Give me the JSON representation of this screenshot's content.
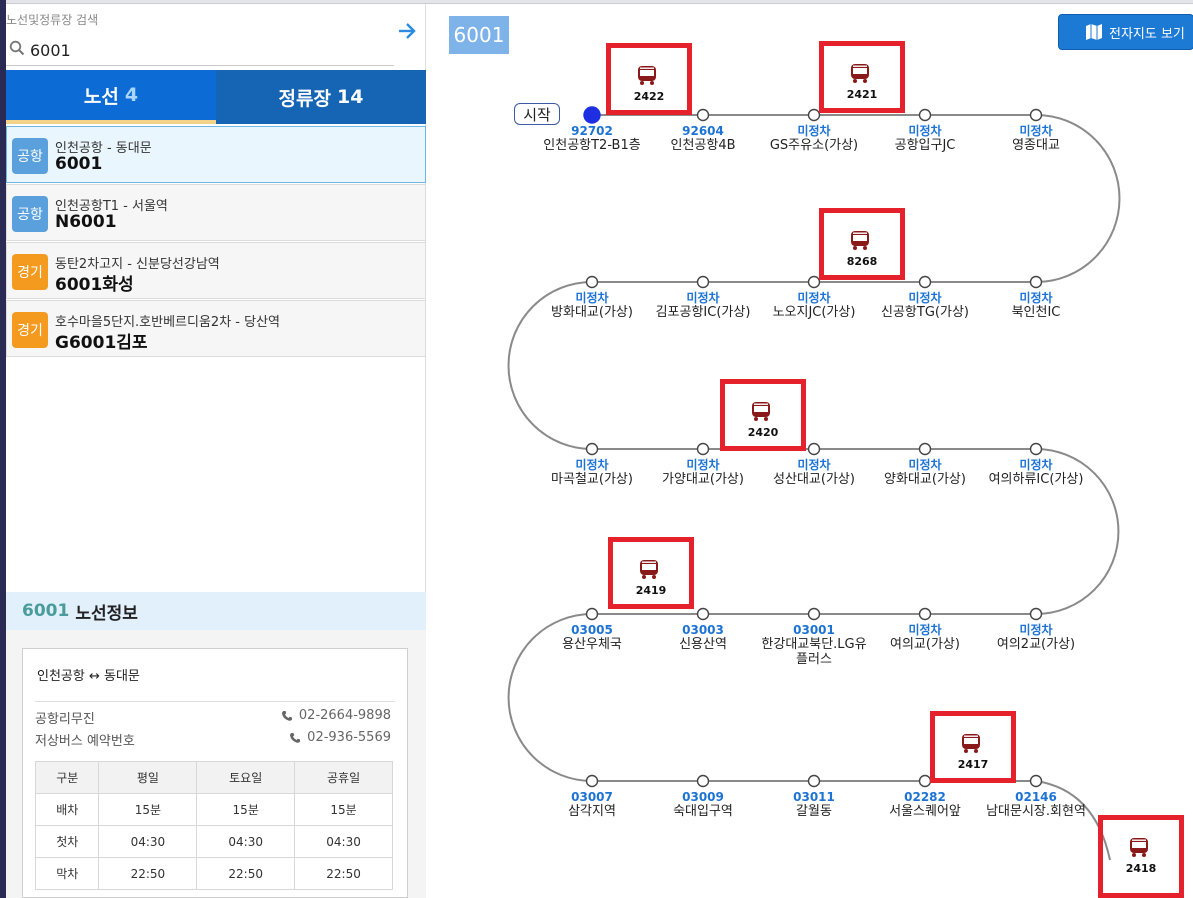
{
  "search": {
    "label": "노선및정류장 검색",
    "value": "6001"
  },
  "tabs": [
    {
      "label": "노선",
      "count": "4"
    },
    {
      "label": "정류장",
      "count": "14"
    }
  ],
  "routes": [
    {
      "badge": "공항",
      "sub": "인천공항 - 동대문",
      "num": "6001"
    },
    {
      "badge": "공항",
      "sub": "인천공항T1 - 서울역",
      "num": "N6001"
    },
    {
      "badge": "경기",
      "sub": "동탄2차고지 - 신분당선강남역",
      "num": "6001화성"
    },
    {
      "badge": "경기",
      "sub": "호수마을5단지.호반베르디움2차 - 당산역",
      "num": "G6001김포"
    }
  ],
  "info": {
    "num": "6001",
    "title": "노선정보",
    "route": "인천공항 ↔ 동대문",
    "company": "공항리무진",
    "company_phone": "02-2664-9898",
    "reserve_label": "저상버스 예약번호",
    "reserve_phone": "02-936-5569",
    "table": {
      "headers": [
        "구분",
        "평일",
        "토요일",
        "공휴일"
      ],
      "rows": [
        [
          "배차",
          "15분",
          "15분",
          "15분"
        ],
        [
          "첫차",
          "04:30",
          "04:30",
          "04:30"
        ],
        [
          "막차",
          "22:50",
          "22:50",
          "22:50"
        ]
      ]
    }
  },
  "route_tag": "6001",
  "map_button": "전자지도 보기",
  "start_label": "시작",
  "stops": [
    {
      "id": "92702",
      "name": "인천공항T2-B1층"
    },
    {
      "id": "92604",
      "name": "인천공항4B"
    },
    {
      "id": "미정차",
      "name": "GS주유소(가상)"
    },
    {
      "id": "미정차",
      "name": "공항입구JC"
    },
    {
      "id": "미정차",
      "name": "영종대교"
    },
    {
      "id": "미정차",
      "name": "북인천IC"
    },
    {
      "id": "미정차",
      "name": "신공항TG(가상)"
    },
    {
      "id": "미정차",
      "name": "노오지JC(가상)"
    },
    {
      "id": "미정차",
      "name": "김포공항IC(가상)"
    },
    {
      "id": "미정차",
      "name": "방화대교(가상)"
    },
    {
      "id": "미정차",
      "name": "마곡철교(가상)"
    },
    {
      "id": "미정차",
      "name": "가양대교(가상)"
    },
    {
      "id": "미정차",
      "name": "성산대교(가상)"
    },
    {
      "id": "미정차",
      "name": "양화대교(가상)"
    },
    {
      "id": "미정차",
      "name": "여의하류IC(가상)"
    },
    {
      "id": "미정차",
      "name": "여의2교(가상)"
    },
    {
      "id": "미정차",
      "name": "여의교(가상)"
    },
    {
      "id": "03001",
      "name": "한강대교북단.LG유플러스"
    },
    {
      "id": "03003",
      "name": "신용산역"
    },
    {
      "id": "03005",
      "name": "용산우체국"
    },
    {
      "id": "03007",
      "name": "삼각지역"
    },
    {
      "id": "03009",
      "name": "숙대입구역"
    },
    {
      "id": "03011",
      "name": "갈월동"
    },
    {
      "id": "02282",
      "name": "서울스퀘어앞"
    },
    {
      "id": "02146",
      "name": "남대문시장.회현역"
    }
  ],
  "buses": [
    {
      "num": "2422",
      "icon": "airport-bus-icon"
    },
    {
      "num": "2421",
      "icon": "airport-bus-icon"
    },
    {
      "num": "8268",
      "icon": "airport-bus-icon"
    },
    {
      "num": "2420",
      "icon": "airport-bus-icon"
    },
    {
      "num": "2419",
      "icon": "airport-bus-icon"
    },
    {
      "num": "2417",
      "icon": "airport-bus-icon"
    },
    {
      "num": "2418",
      "icon": "airport-bus-icon"
    }
  ],
  "colors": {
    "accent": "#0c6bd4",
    "stop_id": "#1c73d4",
    "bus_box": "#e5222b",
    "bus_icon": "#8a1a1a"
  }
}
